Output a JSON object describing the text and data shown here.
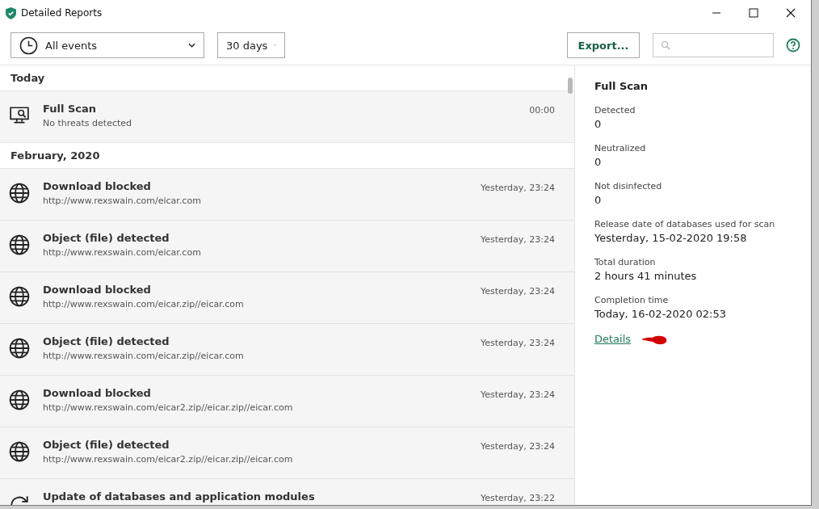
{
  "window": {
    "title": "Detailed Reports"
  },
  "toolbar": {
    "event_filter": "All events",
    "period": "30 days",
    "export_button": "Export..."
  },
  "groups": [
    {
      "label": "Today",
      "events": [
        {
          "kind": "scan",
          "title": "Full Scan",
          "subtitle": "No threats detected",
          "time": "00:00"
        }
      ]
    },
    {
      "label": "February, 2020",
      "events": [
        {
          "kind": "web",
          "title": "Download blocked",
          "subtitle": "http://www.rexswain.com/eicar.com",
          "time": "Yesterday, 23:24"
        },
        {
          "kind": "web",
          "title": "Object (file) detected",
          "subtitle": "http://www.rexswain.com/eicar.com",
          "time": "Yesterday, 23:24"
        },
        {
          "kind": "web",
          "title": "Download blocked",
          "subtitle": "http://www.rexswain.com/eicar.zip//eicar.com",
          "time": "Yesterday, 23:24"
        },
        {
          "kind": "web",
          "title": "Object (file) detected",
          "subtitle": "http://www.rexswain.com/eicar.zip//eicar.com",
          "time": "Yesterday, 23:24"
        },
        {
          "kind": "web",
          "title": "Download blocked",
          "subtitle": "http://www.rexswain.com/eicar2.zip//eicar.zip//eicar.com",
          "time": "Yesterday, 23:24"
        },
        {
          "kind": "web",
          "title": "Object (file) detected",
          "subtitle": "http://www.rexswain.com/eicar2.zip//eicar.zip//eicar.com",
          "time": "Yesterday, 23:24"
        },
        {
          "kind": "update",
          "title": "Update of databases and application modules",
          "time": "Yesterday, 23:22"
        }
      ]
    }
  ],
  "details": {
    "title": "Full Scan",
    "fields": [
      {
        "label": "Detected",
        "value": "0"
      },
      {
        "label": "Neutralized",
        "value": "0"
      },
      {
        "label": "Not disinfected",
        "value": "0"
      },
      {
        "label": "Release date of databases used for scan",
        "value": "Yesterday, 15-02-2020 19:58"
      },
      {
        "label": "Total duration",
        "value": "2 hours 41 minutes"
      },
      {
        "label": "Completion time",
        "value": "Today, 16-02-2020 02:53"
      }
    ],
    "link": "Details"
  }
}
